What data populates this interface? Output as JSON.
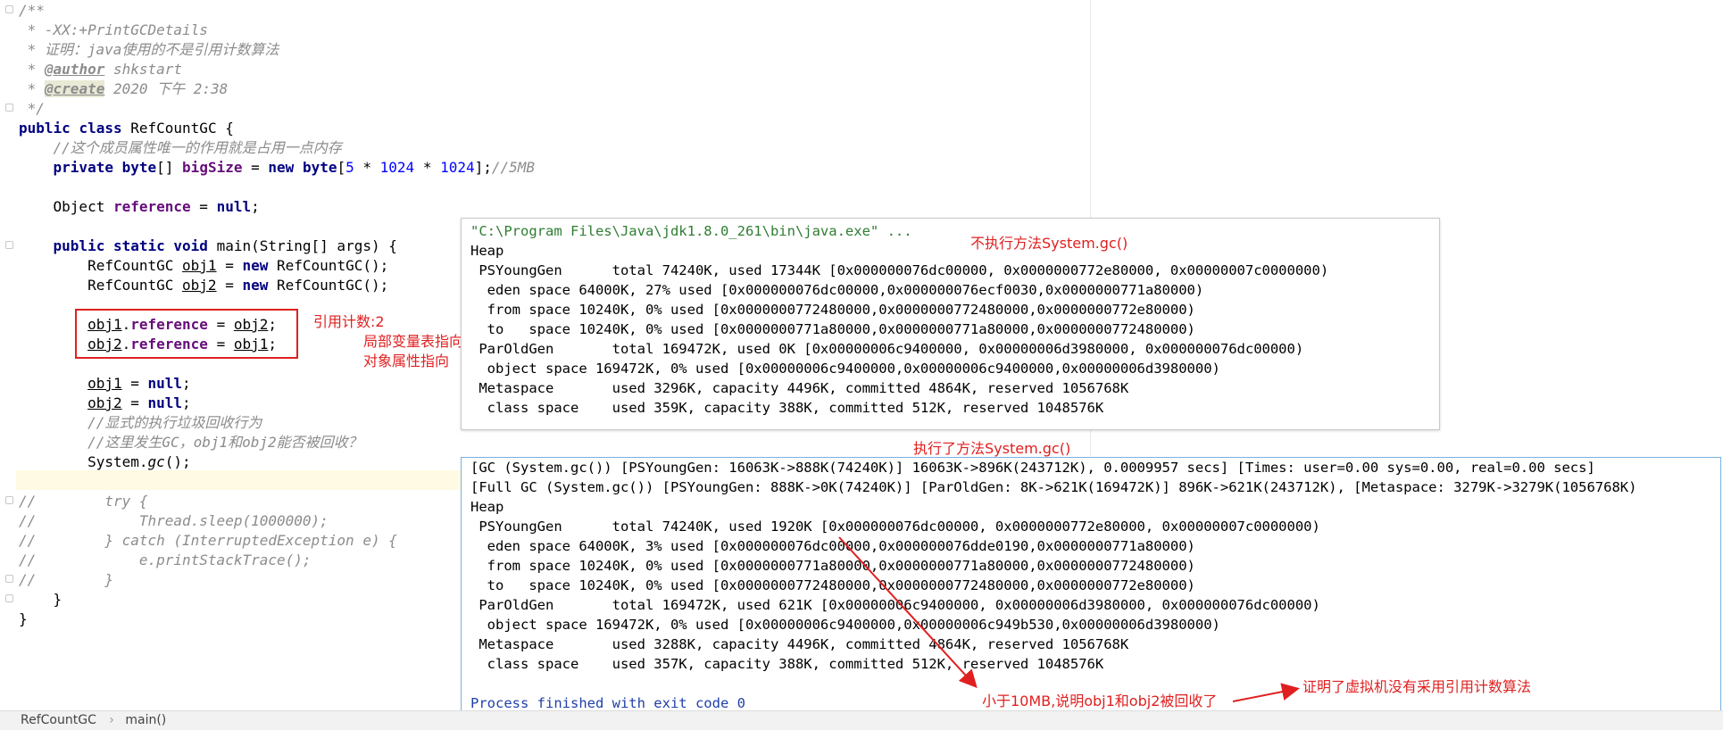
{
  "code_lines": [
    "/**",
    " * -XX:+PrintGCDetails",
    " * 证明：java使用的不是引用计数算法",
    " * @author shkstart",
    " * @create 2020 下午 2:38",
    " */",
    "public class RefCountGC {",
    "    //这个成员属性唯一的作用就是占用一点内存",
    "    private byte[] bigSize = new byte[5 * 1024 * 1024];//5MB",
    "",
    "    Object reference = null;",
    "",
    "    public static void main(String[] args) {",
    "        RefCountGC obj1 = new RefCountGC();",
    "        RefCountGC obj2 = new RefCountGC();",
    "",
    "        obj1.reference = obj2;",
    "        obj2.reference = obj1;",
    "",
    "        obj1 = null;",
    "        obj2 = null;",
    "        //显式的执行垃圾回收行为",
    "        //这里发生GC，obj1和obj2能否被回收？",
    "        System.gc();",
    "",
    "//        try {",
    "//            Thread.sleep(1000000);",
    "//        } catch (InterruptedException e) {",
    "//            e.printStackTrace();",
    "//        }",
    "    }",
    "}"
  ],
  "console1": [
    "\"C:\\Program Files\\Java\\jdk1.8.0_261\\bin\\java.exe\" ...",
    "Heap",
    " PSYoungGen      total 74240K, used 17344K [0x000000076dc00000, 0x0000000772e80000, 0x00000007c0000000)",
    "  eden space 64000K, 27% used [0x000000076dc00000,0x000000076ecf0030,0x0000000771a80000)",
    "  from space 10240K, 0% used [0x0000000772480000,0x0000000772480000,0x0000000772e80000)",
    "  to   space 10240K, 0% used [0x0000000771a80000,0x0000000771a80000,0x0000000772480000)",
    " ParOldGen       total 169472K, used 0K [0x00000006c9400000, 0x00000006d3980000, 0x000000076dc00000)",
    "  object space 169472K, 0% used [0x00000006c9400000,0x00000006c9400000,0x00000006d3980000)",
    " Metaspace       used 3296K, capacity 4496K, committed 4864K, reserved 1056768K",
    "  class space    used 359K, capacity 388K, committed 512K, reserved 1048576K"
  ],
  "console2": [
    "[GC (System.gc()) [PSYoungGen: 16063K->888K(74240K)] 16063K->896K(243712K), 0.0009957 secs] [Times: user=0.00 sys=0.00, real=0.00 secs]",
    "[Full GC (System.gc()) [PSYoungGen: 888K->0K(74240K)] [ParOldGen: 8K->621K(169472K)] 896K->621K(243712K), [Metaspace: 3279K->3279K(1056768K)",
    "Heap",
    " PSYoungGen      total 74240K, used 1920K [0x000000076dc00000, 0x0000000772e80000, 0x00000007c0000000)",
    "  eden space 64000K, 3% used [0x000000076dc00000,0x000000076dde0190,0x0000000771a80000)",
    "  from space 10240K, 0% used [0x0000000771a80000,0x0000000771a80000,0x0000000772480000)",
    "  to   space 10240K, 0% used [0x0000000772480000,0x0000000772480000,0x0000000772e80000)",
    " ParOldGen       total 169472K, used 621K [0x00000006c9400000, 0x00000006d3980000, 0x000000076dc00000)",
    "  object space 169472K, 0% used [0x00000006c9400000,0x00000006c949b530,0x00000006d3980000)",
    " Metaspace       used 3288K, capacity 4496K, committed 4864K, reserved 1056768K",
    "  class space    used 357K, capacity 388K, committed 512K, reserved 1048576K",
    "",
    "Process finished with exit code 0"
  ],
  "annotations": {
    "ref_count": "引用计数:2",
    "local_var": "局部变量表指向",
    "obj_field": "对象属性指向",
    "no_gc": "不执行方法System.gc()",
    "did_gc": "执行了方法System.gc()",
    "less_10mb": "小于10MB,说明obj1和obj2被回收了",
    "proof": "证明了虚拟机没有采用引用计数算法"
  },
  "breadcrumb": {
    "class_name": "RefCountGC",
    "separator": "›",
    "method": "main()"
  },
  "colors": {
    "annotation_red": "#e02020",
    "keyword": "#000080",
    "number": "#0000ff",
    "field": "#660e7a",
    "comment": "#8c8c8c"
  }
}
